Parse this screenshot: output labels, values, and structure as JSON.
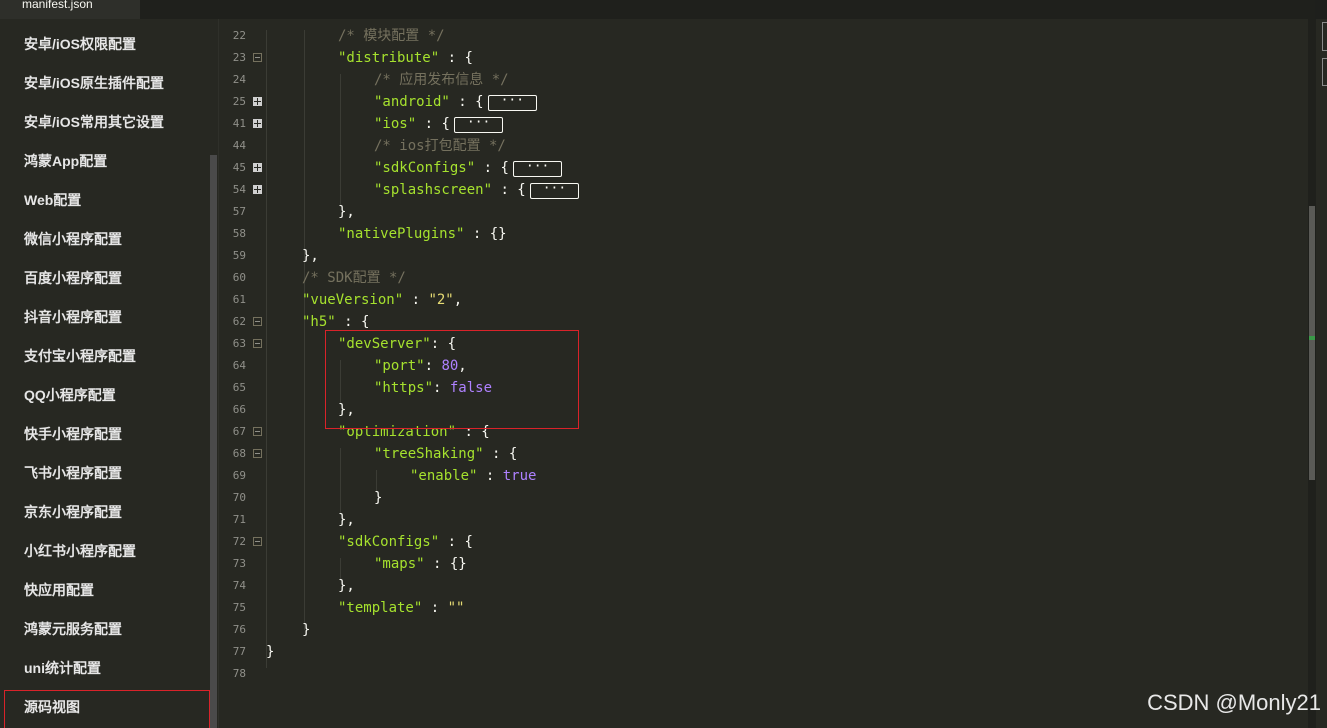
{
  "tab": {
    "title": "manifest.json"
  },
  "sidebar": {
    "items": [
      "安卓/iOS权限配置",
      "安卓/iOS原生插件配置",
      "安卓/iOS常用其它设置",
      "鸿蒙App配置",
      "Web配置",
      "微信小程序配置",
      "百度小程序配置",
      "抖音小程序配置",
      "支付宝小程序配置",
      "QQ小程序配置",
      "快手小程序配置",
      "飞书小程序配置",
      "京东小程序配置",
      "小红书小程序配置",
      "快应用配置",
      "鸿蒙元服务配置",
      "uni统计配置",
      "源码视图"
    ],
    "active": "源码视图"
  },
  "editor": {
    "collapsed_marker": "···",
    "lines": [
      {
        "n": "22",
        "fold": ""
      },
      {
        "n": "23",
        "fold": "minus"
      },
      {
        "n": "24",
        "fold": ""
      },
      {
        "n": "25",
        "fold": "plus"
      },
      {
        "n": "41",
        "fold": "plus"
      },
      {
        "n": "44",
        "fold": ""
      },
      {
        "n": "45",
        "fold": "plus"
      },
      {
        "n": "54",
        "fold": "plus"
      },
      {
        "n": "57",
        "fold": ""
      },
      {
        "n": "58",
        "fold": ""
      },
      {
        "n": "59",
        "fold": ""
      },
      {
        "n": "60",
        "fold": ""
      },
      {
        "n": "61",
        "fold": ""
      },
      {
        "n": "62",
        "fold": "minus"
      },
      {
        "n": "63",
        "fold": "minus"
      },
      {
        "n": "64",
        "fold": ""
      },
      {
        "n": "65",
        "fold": ""
      },
      {
        "n": "66",
        "fold": ""
      },
      {
        "n": "67",
        "fold": "minus"
      },
      {
        "n": "68",
        "fold": "minus"
      },
      {
        "n": "69",
        "fold": ""
      },
      {
        "n": "70",
        "fold": ""
      },
      {
        "n": "71",
        "fold": ""
      },
      {
        "n": "72",
        "fold": "minus"
      },
      {
        "n": "73",
        "fold": ""
      },
      {
        "n": "74",
        "fold": ""
      },
      {
        "n": "75",
        "fold": ""
      },
      {
        "n": "76",
        "fold": ""
      },
      {
        "n": "77",
        "fold": ""
      },
      {
        "n": "78",
        "fold": ""
      }
    ],
    "code": {
      "c22": "/* 模块配置 */",
      "k23": "\"distribute\"",
      "c24": "/* 应用发布信息 */",
      "k25": "\"android\"",
      "k41": "\"ios\"",
      "c44": "/* ios打包配置 */",
      "k45": "\"sdkConfigs\"",
      "k54": "\"splashscreen\"",
      "k58": "\"nativePlugins\"",
      "c60": "/* SDK配置 */",
      "k61": "\"vueVersion\"",
      "s61": "\"2\"",
      "k62": "\"h5\"",
      "k63": "\"devServer\"",
      "k64": "\"port\"",
      "n64": "80",
      "k65": "\"https\"",
      "n65": "false",
      "k67": "\"optimization\"",
      "k68": "\"treeShaking\"",
      "k69": "\"enable\"",
      "n69": "true",
      "k72": "\"sdkConfigs\"",
      "k73": "\"maps\"",
      "k75": "\"template\"",
      "s75": "\"\""
    }
  },
  "watermark": "CSDN @Monly21",
  "colors": {
    "highlight_border": "#d9232a",
    "background": "#272822"
  }
}
